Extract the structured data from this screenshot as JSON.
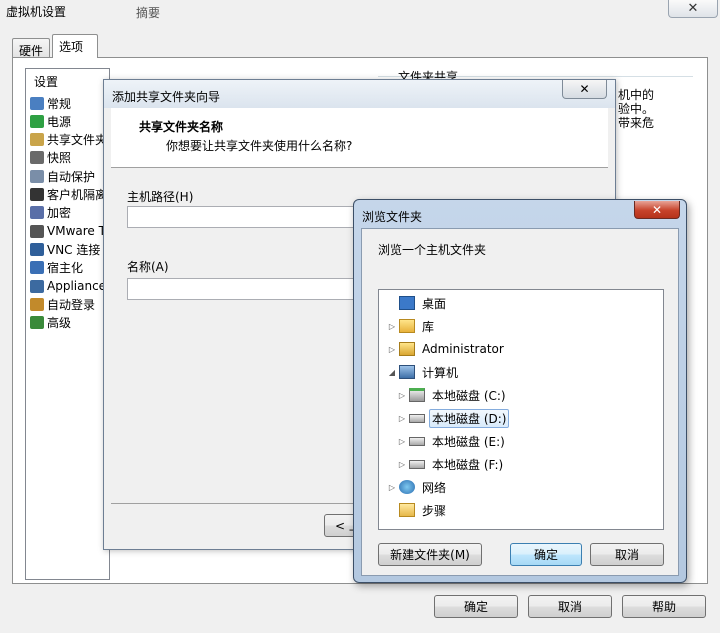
{
  "main_window": {
    "title": "虚拟机设置",
    "close_glyph": "✕",
    "tabs": [
      {
        "label": "硬件",
        "active": false
      },
      {
        "label": "选项",
        "active": true
      }
    ],
    "settings_header": "设置",
    "column_header": "摘要",
    "settings_items": [
      {
        "label": "常规",
        "icon": "monitor-icon"
      },
      {
        "label": "电源",
        "icon": "play-icon"
      },
      {
        "label": "共享文件夹",
        "icon": "shared-folder-icon"
      },
      {
        "label": "快照",
        "icon": "snapshot-icon"
      },
      {
        "label": "自动保护",
        "icon": "clock-icon"
      },
      {
        "label": "客户机隔离",
        "icon": "lock-icon"
      },
      {
        "label": "加密",
        "icon": "encryption-icon"
      },
      {
        "label": "VMware T",
        "icon": "vm-icon"
      },
      {
        "label": "VNC 连接",
        "icon": "vnc-icon"
      },
      {
        "label": "宿主化",
        "icon": "unity-icon"
      },
      {
        "label": "Appliance",
        "icon": "appliance-icon"
      },
      {
        "label": "自动登录",
        "icon": "users-icon"
      },
      {
        "label": "高级",
        "icon": "advanced-icon"
      }
    ],
    "shared_folders_title": "文件夹共享",
    "right_description": [
      "机中的",
      "验中。",
      "带来危"
    ],
    "buttons": {
      "ok": "确定",
      "cancel": "取消",
      "help": "帮助"
    }
  },
  "wizard": {
    "title": "添加共享文件夹向导",
    "close_glyph": "✕",
    "heading": "共享文件夹名称",
    "subheading": "你想要让共享文件夹使用什么名称?",
    "host_path_label": "主机路径(H)",
    "host_path_value": "",
    "name_label": "名称(A)",
    "name_value": "",
    "back_button": "< 上"
  },
  "browse_dialog": {
    "title": "浏览文件夹",
    "close_glyph": "✕",
    "description": "浏览一个主机文件夹",
    "tree": [
      {
        "label": "桌面",
        "level": 0,
        "arrow": "",
        "icon": "desktop-icon",
        "selected": false
      },
      {
        "label": "库",
        "level": 0,
        "arrow": "▷",
        "icon": "library-icon",
        "selected": false
      },
      {
        "label": "Administrator",
        "level": 0,
        "arrow": "▷",
        "icon": "user-folder-icon",
        "selected": false
      },
      {
        "label": "计算机",
        "level": 0,
        "arrow": "◢",
        "icon": "computer-icon",
        "selected": false
      },
      {
        "label": "本地磁盘 (C:)",
        "level": 1,
        "arrow": "▷",
        "icon": "system-drive-icon",
        "selected": false
      },
      {
        "label": "本地磁盘 (D:)",
        "level": 1,
        "arrow": "▷",
        "icon": "drive-icon",
        "selected": true
      },
      {
        "label": "本地磁盘 (E:)",
        "level": 1,
        "arrow": "▷",
        "icon": "drive-icon",
        "selected": false
      },
      {
        "label": "本地磁盘 (F:)",
        "level": 1,
        "arrow": "▷",
        "icon": "drive-icon",
        "selected": false
      },
      {
        "label": "网络",
        "level": 0,
        "arrow": "▷",
        "icon": "network-icon",
        "selected": false
      },
      {
        "label": "步骤",
        "level": 0,
        "arrow": "",
        "icon": "folder-icon",
        "selected": false
      }
    ],
    "buttons": {
      "new_folder": "新建文件夹(M)",
      "ok": "确定",
      "cancel": "取消"
    }
  },
  "colors": {
    "window_bg": "#f0f0f0",
    "dialog_frame": "#b9cde4",
    "selection": "#d9ebfb",
    "close_red": "#c7432b"
  }
}
